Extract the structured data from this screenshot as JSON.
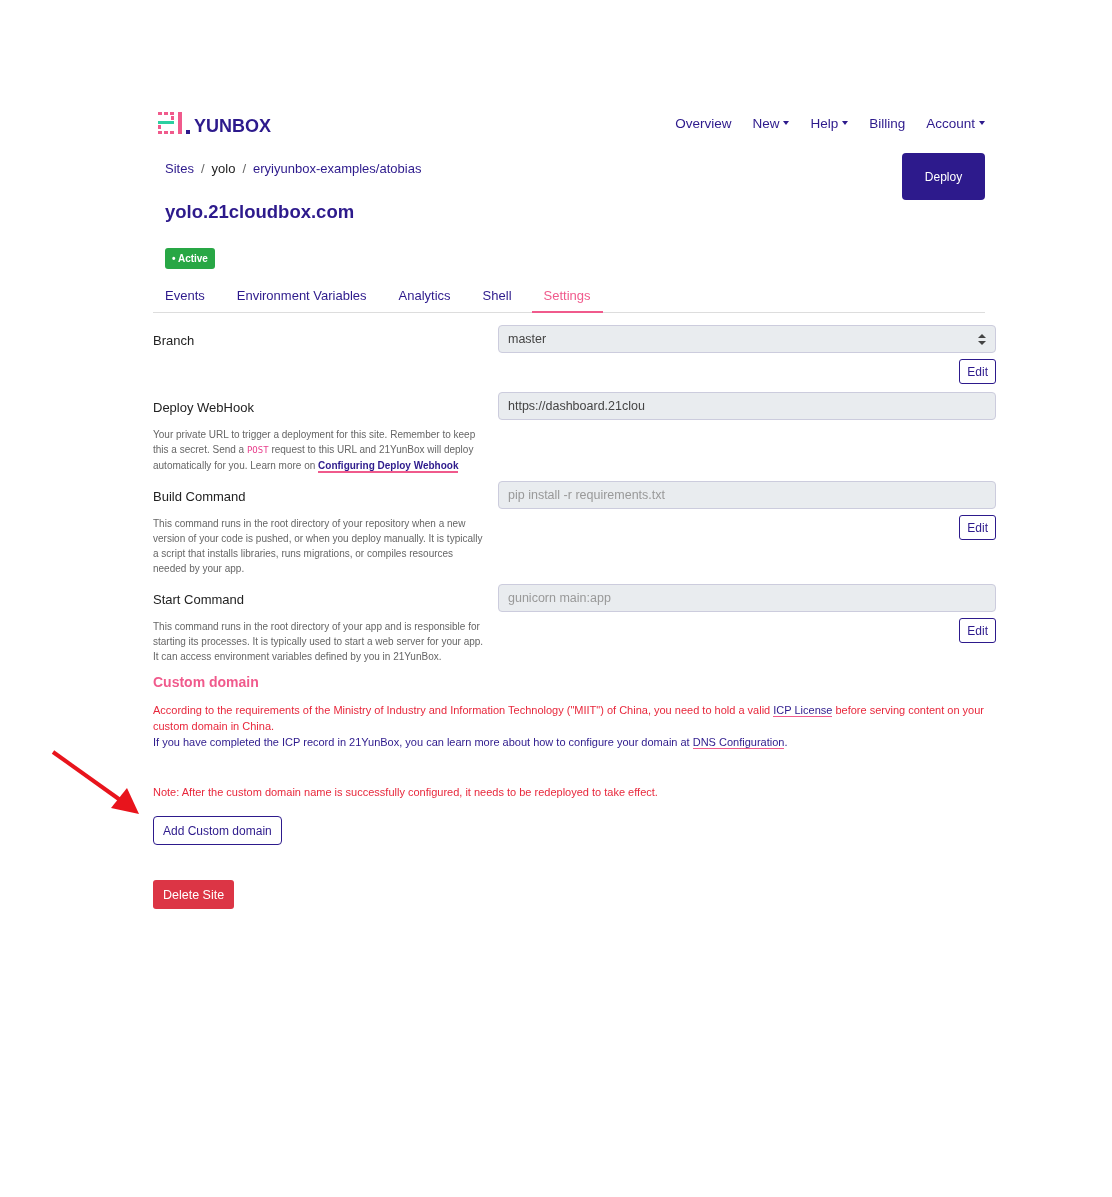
{
  "logo": {
    "text": "YUNBOX"
  },
  "nav": [
    {
      "label": "Overview",
      "dropdown": false
    },
    {
      "label": "New",
      "dropdown": true
    },
    {
      "label": "Help",
      "dropdown": true
    },
    {
      "label": "Billing",
      "dropdown": false
    },
    {
      "label": "Account",
      "dropdown": true
    }
  ],
  "breadcrumb": [
    {
      "label": "Sites",
      "link": true
    },
    {
      "separator": "/",
      "label": "yolo",
      "link": false
    },
    {
      "separator": "/",
      "label": "eryiyunbox-examples/atobias",
      "link": true
    }
  ],
  "deploy_button": "Deploy",
  "site_title": "yolo.21cloudbox.com",
  "status": {
    "label": "• Active"
  },
  "tabs": [
    {
      "label": "Events",
      "selected": false
    },
    {
      "label": "Environment Variables",
      "selected": false
    },
    {
      "label": "Analytics",
      "selected": false
    },
    {
      "label": "Shell",
      "selected": false
    },
    {
      "label": "Settings",
      "selected": true
    }
  ],
  "settings": [
    {
      "label": "Branch",
      "kind": "select",
      "value": "master",
      "edit": "Edit"
    },
    {
      "label": "Deploy WebHook",
      "kind": "input",
      "value": "https://dashboard.21clou",
      "description": [
        {
          "kind": "text",
          "text": "Your private URL to trigger a deployment for this site. Remember to keep this a secret. Send a "
        },
        {
          "kind": "code",
          "text": "POST"
        },
        {
          "kind": "text",
          "text": " request to this URL and 21YunBox will deploy automatically for you. Learn more on "
        },
        {
          "kind": "link",
          "text": "Configuring Deploy Webhook"
        }
      ]
    },
    {
      "label": "Build Command",
      "kind": "input",
      "placeholder": "pip install -r requirements.txt",
      "edit": "Edit",
      "description": [
        {
          "kind": "text",
          "text": "This command runs in the root directory of your repository when a new version of your code is pushed, or when you deploy manually. It is typically a script that installs libraries, runs migrations, or compiles resources needed by your app."
        }
      ]
    },
    {
      "label": "Start Command",
      "kind": "input",
      "placeholder": "gunicorn main:app",
      "edit": "Edit",
      "description": [
        {
          "kind": "text",
          "text": "This command runs in the root directory of your app and is responsible for starting its processes. It is typically used to start a web server for your app. It can access environment variables defined by you in 21YunBox."
        }
      ]
    }
  ],
  "custom_domain": {
    "title": "Custom domain",
    "paragraphs": [
      {
        "color": "#e8283c",
        "parts": [
          {
            "kind": "text",
            "text": "According to the requirements of the Ministry of Industry and Information Technology (\"MIIT\") of China, you need to hold a valid "
          },
          {
            "kind": "link",
            "text": "ICP License"
          },
          {
            "kind": "text",
            "text": " before serving content on your custom domain in China."
          }
        ]
      },
      {
        "color": "#2d1a8c",
        "parts": [
          {
            "kind": "text",
            "text": "If you have completed the ICP record in 21YunBox, you can learn more about how to configure your domain at "
          },
          {
            "kind": "link",
            "text": "DNS Configuration"
          },
          {
            "kind": "text",
            "text": "."
          }
        ]
      }
    ],
    "note": "Note: After the custom domain name is successfully configured, it needs to be redeployed to take effect.",
    "add_button": "Add Custom domain"
  },
  "delete_button": "Delete Site"
}
